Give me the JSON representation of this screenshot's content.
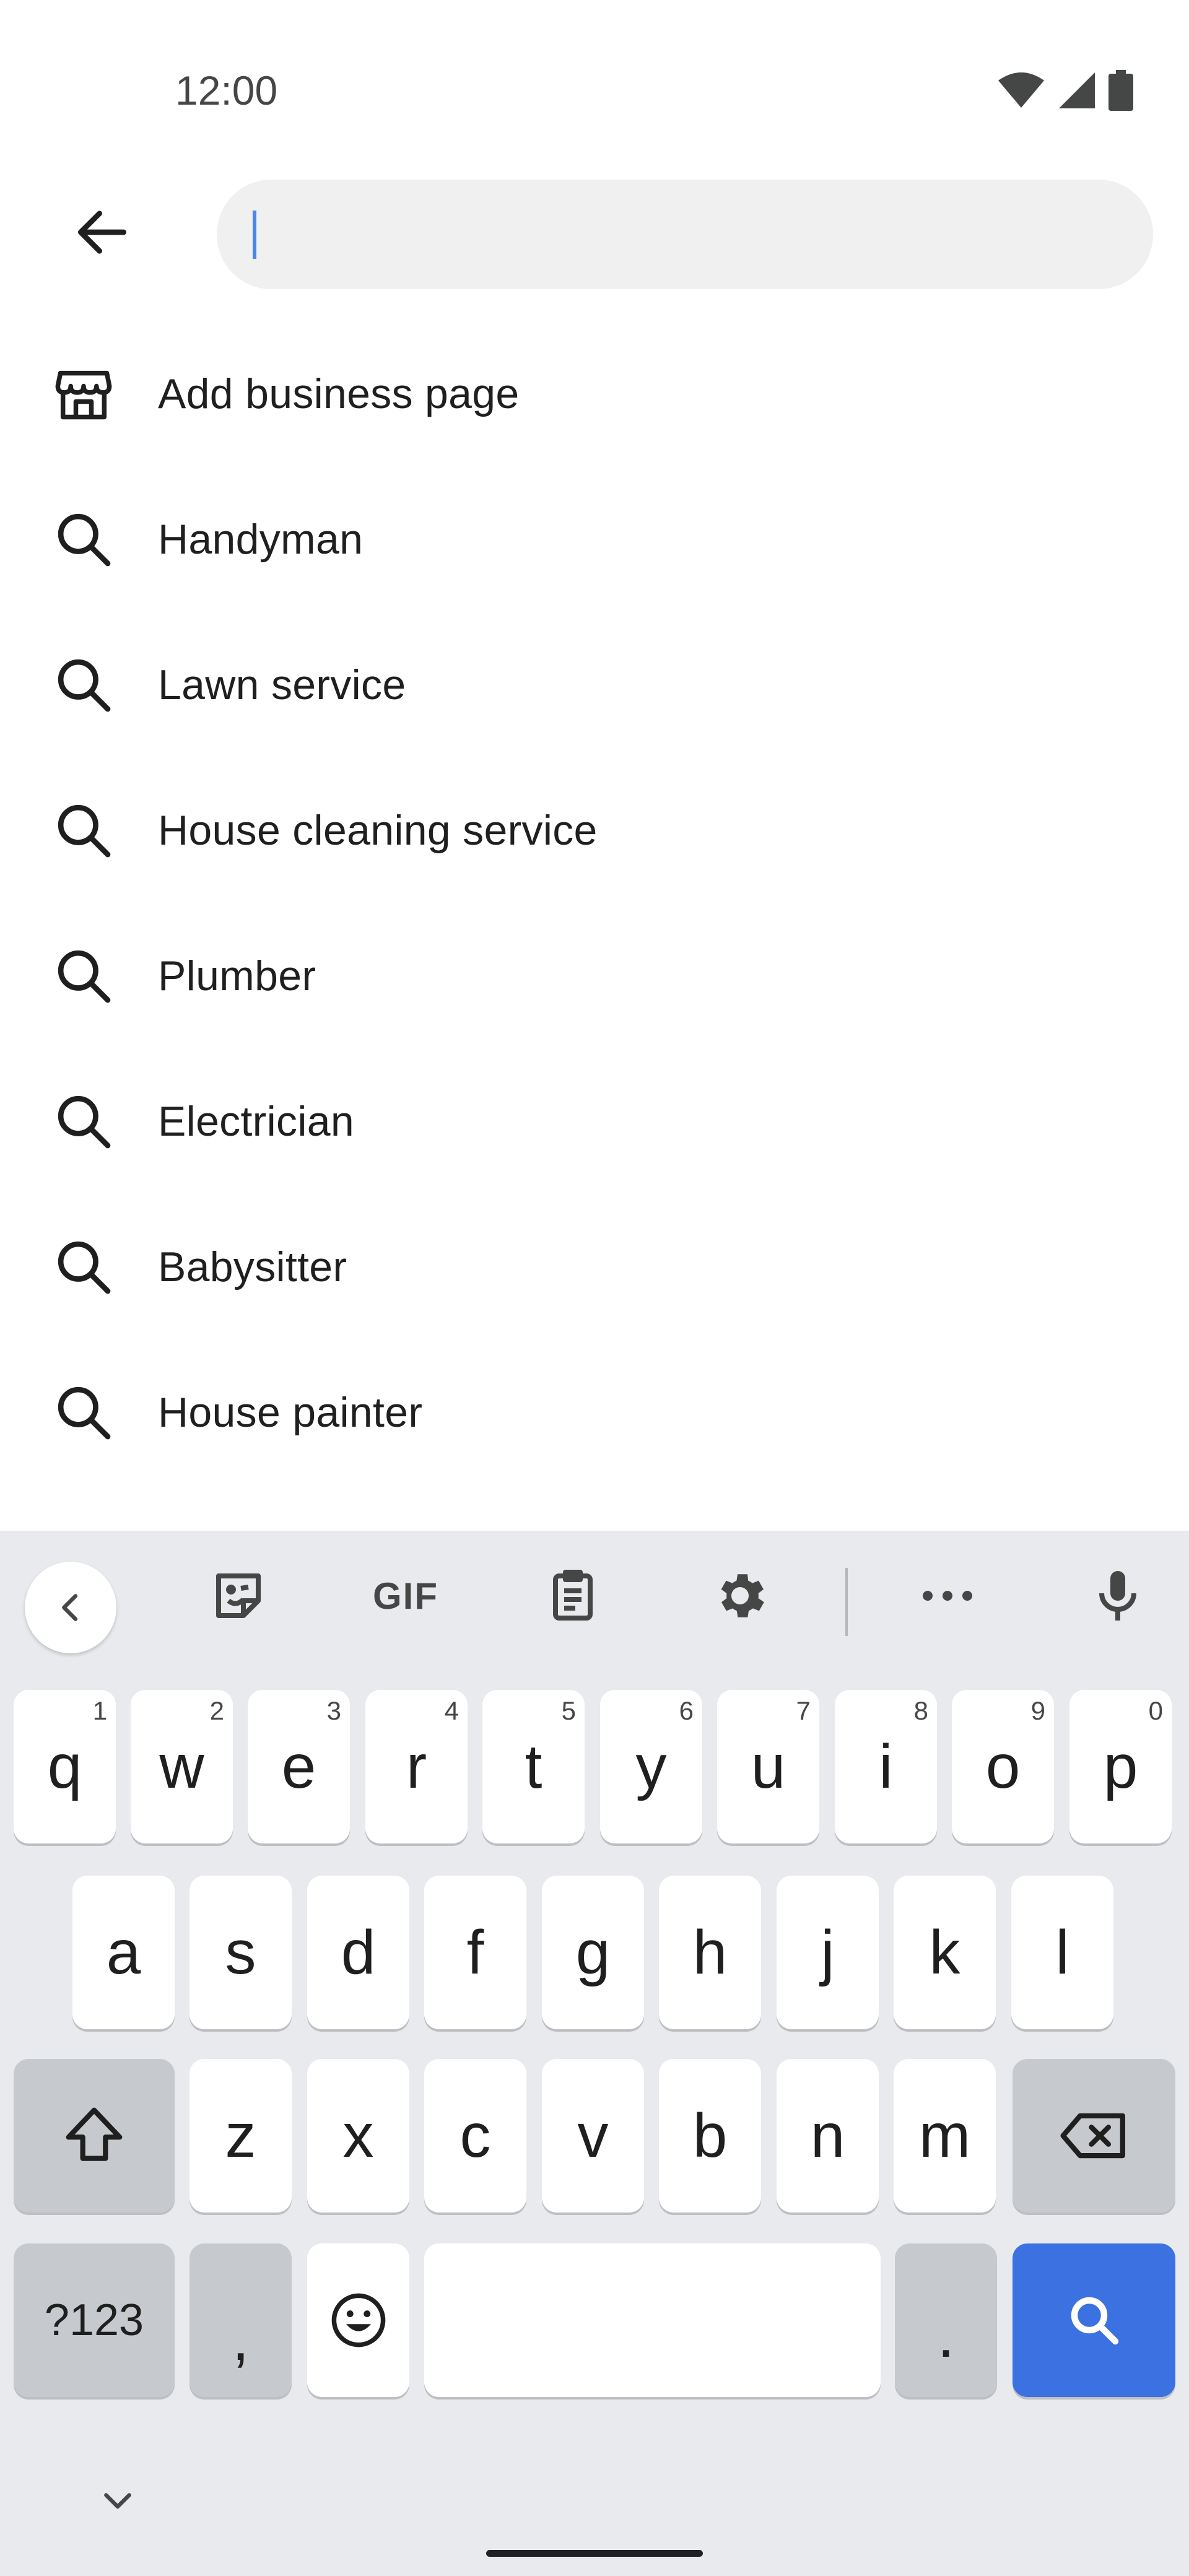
{
  "status_bar": {
    "time": "12:00",
    "icons": [
      "wifi-icon",
      "cell-signal-icon",
      "battery-icon"
    ]
  },
  "search": {
    "value": "",
    "placeholder": "",
    "back_icon": "arrow-back-icon"
  },
  "suggestions": [
    {
      "icon": "storefront-icon",
      "label": "Add business page"
    },
    {
      "icon": "search-icon",
      "label": "Handyman"
    },
    {
      "icon": "search-icon",
      "label": "Lawn service"
    },
    {
      "icon": "search-icon",
      "label": "House cleaning service"
    },
    {
      "icon": "search-icon",
      "label": "Plumber"
    },
    {
      "icon": "search-icon",
      "label": "Electrician"
    },
    {
      "icon": "search-icon",
      "label": "Babysitter"
    },
    {
      "icon": "search-icon",
      "label": "House painter"
    }
  ],
  "keyboard": {
    "toolbar": [
      "collapse-chevron-icon",
      "sticker-icon",
      "gif-icon",
      "clipboard-icon",
      "settings-gear-icon",
      "more-icon",
      "microphone-icon"
    ],
    "gif_label": "GIF",
    "rows": {
      "row1": [
        {
          "char": "q",
          "hint": "1"
        },
        {
          "char": "w",
          "hint": "2"
        },
        {
          "char": "e",
          "hint": "3"
        },
        {
          "char": "r",
          "hint": "4"
        },
        {
          "char": "t",
          "hint": "5"
        },
        {
          "char": "y",
          "hint": "6"
        },
        {
          "char": "u",
          "hint": "7"
        },
        {
          "char": "i",
          "hint": "8"
        },
        {
          "char": "o",
          "hint": "9"
        },
        {
          "char": "p",
          "hint": "0"
        }
      ],
      "row2": [
        "a",
        "s",
        "d",
        "f",
        "g",
        "h",
        "j",
        "k",
        "l"
      ],
      "row3": [
        "z",
        "x",
        "c",
        "v",
        "b",
        "n",
        "m"
      ]
    },
    "symbols_label": "?123",
    "comma_label": ",",
    "period_label": ".",
    "accent_color": "#3b71e0"
  }
}
